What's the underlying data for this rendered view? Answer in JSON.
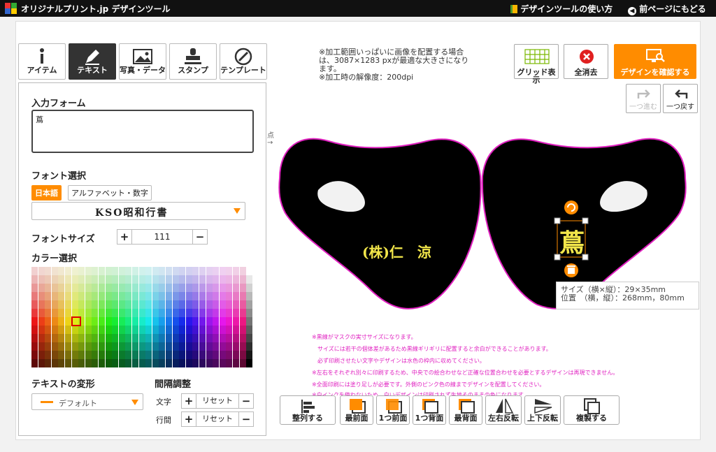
{
  "topbar": {
    "brand": "オリジナルプリント.jp デザインツール",
    "help_link": "デザインツールの使い方",
    "back_link": "前ページにもどる"
  },
  "tabs": [
    {
      "label": "アイテム",
      "icon": "info-icon",
      "active": false
    },
    {
      "label": "テキスト",
      "icon": "pen-icon",
      "active": true
    },
    {
      "label": "写真・データ",
      "icon": "image-icon",
      "active": false
    },
    {
      "label": "スタンプ",
      "icon": "stamp-icon",
      "active": false
    },
    {
      "label": "テンプレート",
      "icon": "template-icon",
      "active": false
    }
  ],
  "text_panel": {
    "input_title": "入力フォーム",
    "input_value": "蔦",
    "font_title": "フォント選択",
    "font_tabs": [
      "日本語",
      "アルファベット・数字"
    ],
    "font_selected": "KSO昭和行書",
    "size_title": "フォントサイズ",
    "size_value": "111",
    "color_title": "カラー選択",
    "transform_title": "テキストの変形",
    "transform_value": "デフォルト",
    "spacing_title": "間隔調整",
    "char_label": "文字",
    "line_label": "行間",
    "reset_label": "リセット"
  },
  "info": {
    "line1": "※加工範囲いっぱいに画像を配置する場合は、3087×1283 pxが最適な大きさになります。",
    "line2": "※加工時の解像度：200dpi"
  },
  "toolbar": {
    "grid_label": "グリッド表示",
    "clear_label": "全消去",
    "confirm_label": "デザインを確認する",
    "redo_label": "一つ進む",
    "undo_label": "一つ戻す"
  },
  "canvas": {
    "point_label": "点",
    "left_text": "(株)仁　涼",
    "right_text": "蔦",
    "accent_color": "#ff8c00",
    "text_color": "#f2e64a",
    "outline_color": "#e020c0"
  },
  "tooltip": {
    "size": "サイズ（横×縦）：29×35mm",
    "pos": "位置　（横，縦）：268mm，80mm"
  },
  "warnings": [
    "※黒線がマスクの実寸サイズになります。",
    "　サイズには若干の個体差があるため黒線ギリギリに配置すると余白ができることがあります。",
    "　必ず印刷させたい文字やデザインは水色の枠内に収めてください。",
    "※左右をそれぞれ別々に印刷するため、中央での絵合わせなど正確な位置合わせを必要とするデザインは再現できません。",
    "※全面印刷には塗り足しが必要です。外側のピンク色の線までデザインを配置してください。",
    "※白インクを使わないため、白いデザインは印刷されず生地そのままの色になります。"
  ],
  "bottom": [
    "整列する",
    "最前面",
    "1つ前面",
    "1つ背面",
    "最背面",
    "左右反転",
    "上下反転",
    "複製する"
  ]
}
